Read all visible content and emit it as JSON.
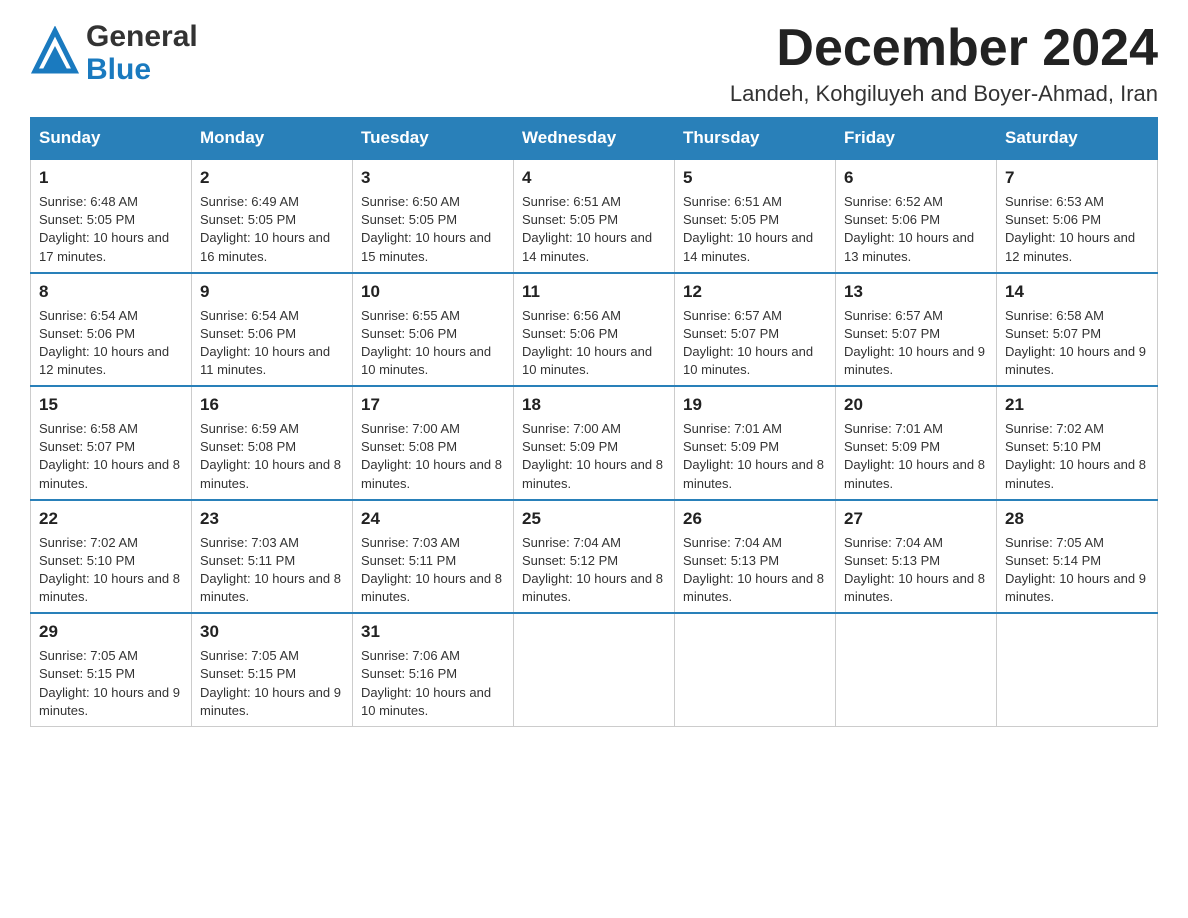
{
  "header": {
    "logo_general": "General",
    "logo_blue": "Blue",
    "month_title": "December 2024",
    "location": "Landeh, Kohgiluyeh and Boyer-Ahmad, Iran"
  },
  "weekdays": [
    "Sunday",
    "Monday",
    "Tuesday",
    "Wednesday",
    "Thursday",
    "Friday",
    "Saturday"
  ],
  "weeks": [
    [
      {
        "day": "1",
        "sunrise": "6:48 AM",
        "sunset": "5:05 PM",
        "daylight": "10 hours and 17 minutes."
      },
      {
        "day": "2",
        "sunrise": "6:49 AM",
        "sunset": "5:05 PM",
        "daylight": "10 hours and 16 minutes."
      },
      {
        "day": "3",
        "sunrise": "6:50 AM",
        "sunset": "5:05 PM",
        "daylight": "10 hours and 15 minutes."
      },
      {
        "day": "4",
        "sunrise": "6:51 AM",
        "sunset": "5:05 PM",
        "daylight": "10 hours and 14 minutes."
      },
      {
        "day": "5",
        "sunrise": "6:51 AM",
        "sunset": "5:05 PM",
        "daylight": "10 hours and 14 minutes."
      },
      {
        "day": "6",
        "sunrise": "6:52 AM",
        "sunset": "5:06 PM",
        "daylight": "10 hours and 13 minutes."
      },
      {
        "day": "7",
        "sunrise": "6:53 AM",
        "sunset": "5:06 PM",
        "daylight": "10 hours and 12 minutes."
      }
    ],
    [
      {
        "day": "8",
        "sunrise": "6:54 AM",
        "sunset": "5:06 PM",
        "daylight": "10 hours and 12 minutes."
      },
      {
        "day": "9",
        "sunrise": "6:54 AM",
        "sunset": "5:06 PM",
        "daylight": "10 hours and 11 minutes."
      },
      {
        "day": "10",
        "sunrise": "6:55 AM",
        "sunset": "5:06 PM",
        "daylight": "10 hours and 10 minutes."
      },
      {
        "day": "11",
        "sunrise": "6:56 AM",
        "sunset": "5:06 PM",
        "daylight": "10 hours and 10 minutes."
      },
      {
        "day": "12",
        "sunrise": "6:57 AM",
        "sunset": "5:07 PM",
        "daylight": "10 hours and 10 minutes."
      },
      {
        "day": "13",
        "sunrise": "6:57 AM",
        "sunset": "5:07 PM",
        "daylight": "10 hours and 9 minutes."
      },
      {
        "day": "14",
        "sunrise": "6:58 AM",
        "sunset": "5:07 PM",
        "daylight": "10 hours and 9 minutes."
      }
    ],
    [
      {
        "day": "15",
        "sunrise": "6:58 AM",
        "sunset": "5:07 PM",
        "daylight": "10 hours and 8 minutes."
      },
      {
        "day": "16",
        "sunrise": "6:59 AM",
        "sunset": "5:08 PM",
        "daylight": "10 hours and 8 minutes."
      },
      {
        "day": "17",
        "sunrise": "7:00 AM",
        "sunset": "5:08 PM",
        "daylight": "10 hours and 8 minutes."
      },
      {
        "day": "18",
        "sunrise": "7:00 AM",
        "sunset": "5:09 PM",
        "daylight": "10 hours and 8 minutes."
      },
      {
        "day": "19",
        "sunrise": "7:01 AM",
        "sunset": "5:09 PM",
        "daylight": "10 hours and 8 minutes."
      },
      {
        "day": "20",
        "sunrise": "7:01 AM",
        "sunset": "5:09 PM",
        "daylight": "10 hours and 8 minutes."
      },
      {
        "day": "21",
        "sunrise": "7:02 AM",
        "sunset": "5:10 PM",
        "daylight": "10 hours and 8 minutes."
      }
    ],
    [
      {
        "day": "22",
        "sunrise": "7:02 AM",
        "sunset": "5:10 PM",
        "daylight": "10 hours and 8 minutes."
      },
      {
        "day": "23",
        "sunrise": "7:03 AM",
        "sunset": "5:11 PM",
        "daylight": "10 hours and 8 minutes."
      },
      {
        "day": "24",
        "sunrise": "7:03 AM",
        "sunset": "5:11 PM",
        "daylight": "10 hours and 8 minutes."
      },
      {
        "day": "25",
        "sunrise": "7:04 AM",
        "sunset": "5:12 PM",
        "daylight": "10 hours and 8 minutes."
      },
      {
        "day": "26",
        "sunrise": "7:04 AM",
        "sunset": "5:13 PM",
        "daylight": "10 hours and 8 minutes."
      },
      {
        "day": "27",
        "sunrise": "7:04 AM",
        "sunset": "5:13 PM",
        "daylight": "10 hours and 8 minutes."
      },
      {
        "day": "28",
        "sunrise": "7:05 AM",
        "sunset": "5:14 PM",
        "daylight": "10 hours and 9 minutes."
      }
    ],
    [
      {
        "day": "29",
        "sunrise": "7:05 AM",
        "sunset": "5:15 PM",
        "daylight": "10 hours and 9 minutes."
      },
      {
        "day": "30",
        "sunrise": "7:05 AM",
        "sunset": "5:15 PM",
        "daylight": "10 hours and 9 minutes."
      },
      {
        "day": "31",
        "sunrise": "7:06 AM",
        "sunset": "5:16 PM",
        "daylight": "10 hours and 10 minutes."
      },
      null,
      null,
      null,
      null
    ]
  ],
  "labels": {
    "sunrise_label": "Sunrise:",
    "sunset_label": "Sunset:",
    "daylight_label": "Daylight:"
  },
  "colors": {
    "header_bg": "#2980b9",
    "accent_blue": "#1a7abf"
  }
}
